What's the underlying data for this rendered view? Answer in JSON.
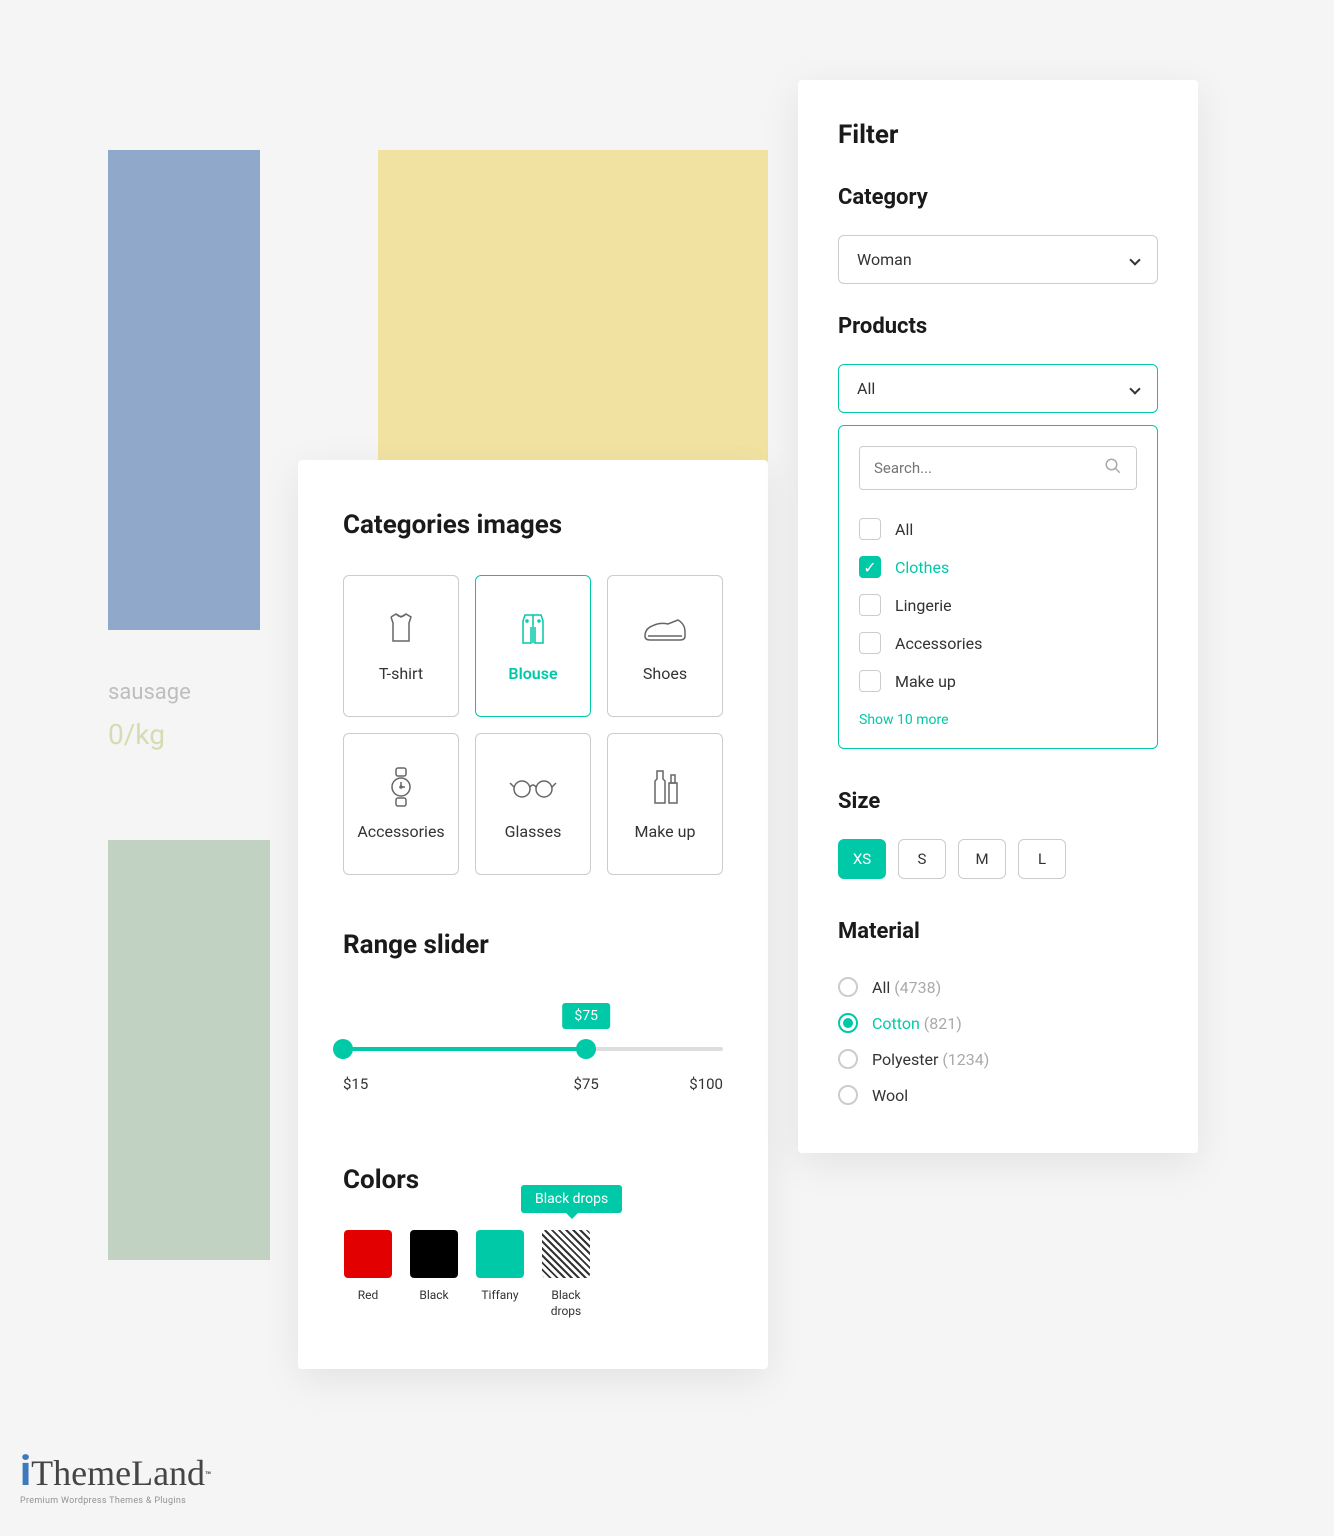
{
  "bg": {
    "product_label": "sausage",
    "product_price": "0/kg"
  },
  "categories": {
    "title": "Categories images",
    "items": [
      {
        "label": "T-shirt",
        "active": false
      },
      {
        "label": "Blouse",
        "active": true
      },
      {
        "label": "Shoes",
        "active": false
      },
      {
        "label": "Accessories",
        "active": false
      },
      {
        "label": "Glasses",
        "active": false
      },
      {
        "label": "Make up",
        "active": false
      }
    ]
  },
  "slider": {
    "title": "Range slider",
    "min_label": "$15",
    "mid_label": "$75",
    "max_label": "$100",
    "tooltip": "$75"
  },
  "colors": {
    "title": "Colors",
    "tooltip": "Black drops",
    "items": [
      {
        "label": "Red",
        "hex": "#e20000"
      },
      {
        "label": "Black",
        "hex": "#000000"
      },
      {
        "label": "Tiffany",
        "hex": "#00c9a7"
      },
      {
        "label": "Black drops",
        "pattern": true
      }
    ]
  },
  "filter": {
    "title": "Filter",
    "category_label": "Category",
    "category_value": "Woman",
    "products_label": "Products",
    "products_value": "All",
    "search_placeholder": "Search...",
    "options": [
      {
        "label": "All",
        "checked": false
      },
      {
        "label": "Clothes",
        "checked": true
      },
      {
        "label": "Lingerie",
        "checked": false
      },
      {
        "label": "Accessories",
        "checked": false
      },
      {
        "label": "Make up",
        "checked": false
      }
    ],
    "show_more": "Show 10 more",
    "size_label": "Size",
    "sizes": [
      {
        "label": "XS",
        "active": true
      },
      {
        "label": "S",
        "active": false
      },
      {
        "label": "M",
        "active": false
      },
      {
        "label": "L",
        "active": false
      }
    ],
    "material_label": "Material",
    "materials": [
      {
        "label": "All",
        "count": "(4738)",
        "selected": false
      },
      {
        "label": "Cotton",
        "count": "(821)",
        "selected": true
      },
      {
        "label": "Polyester",
        "count": "(1234)",
        "selected": false
      },
      {
        "label": "Wool",
        "count": "",
        "selected": false
      }
    ]
  },
  "logo": {
    "brand": "ThemeLand",
    "tag": "Premium Wordpress Themes & Plugins"
  }
}
